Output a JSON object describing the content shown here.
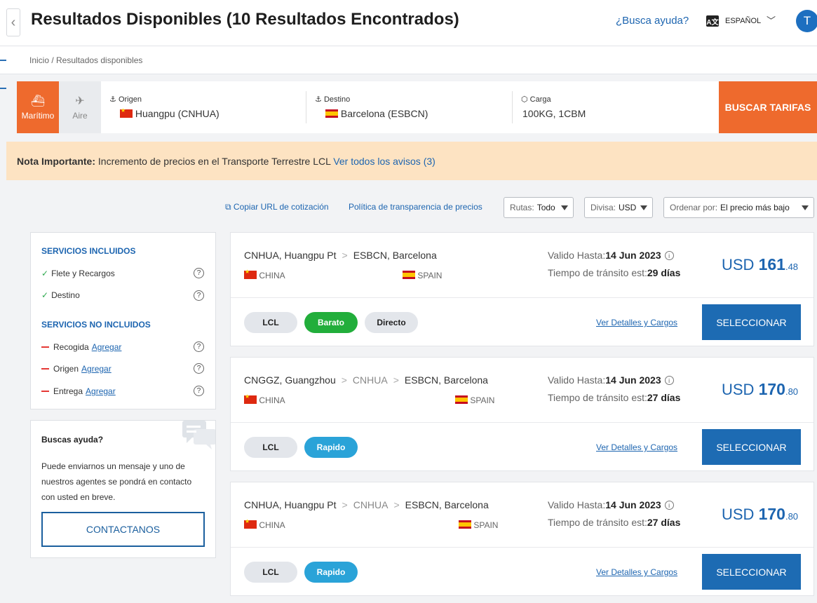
{
  "header": {
    "title": "Resultados Disponibles (10 Resultados Encontrados)",
    "help_link": "¿Busca ayuda?",
    "language": "ESPAÑOL",
    "avatar_initial": "T"
  },
  "breadcrumb": "Inicio / Resultados disponibles",
  "search": {
    "modes": [
      {
        "label": "Marítimo",
        "icon": "ship-icon",
        "active": true
      },
      {
        "label": "Aire",
        "icon": "plane-icon",
        "active": false
      }
    ],
    "origin_label": "Origen",
    "origin_value": "Huangpu (CNHUA)",
    "destination_label": "Destino",
    "destination_value": "Barcelona (ESBCN)",
    "cargo_label": "Carga",
    "cargo_value": "100KG, 1CBM",
    "button": "BUSCAR TARIFAS"
  },
  "notice": {
    "prefix": "Nota Importante:",
    "text": "Incremento de precios en el Transporte Terrestre LCL",
    "link": "Ver todos los avisos (3)"
  },
  "toolbar": {
    "copy_url": "Copiar URL de cotización",
    "policy": "Política de transparencia de precios",
    "routes_label": "Rutas:",
    "routes_value": "Todo",
    "currency_label": "Divisa:",
    "currency_value": "USD",
    "sort_label": "Ordenar por:",
    "sort_value": "El precio más bajo"
  },
  "services": {
    "included_title": "SERVICIOS INCLUIDOS",
    "included": [
      "Flete y Recargos",
      "Destino"
    ],
    "not_included_title": "SERVICIOS NO INCLUIDOS",
    "not_included": [
      "Recogida",
      "Origen",
      "Entrega"
    ],
    "add_label": "Agregar"
  },
  "help_box": {
    "title": "Buscas ayuda?",
    "text": "Puede enviarnos un mensaje y uno de nuestros agentes se pondrá en contacto con usted en breve.",
    "button": "CONTACTANOS"
  },
  "results": [
    {
      "route": [
        "CNHUA, Huangpu Pt",
        "ESBCN, Barcelona"
      ],
      "origin_country": "CHINA",
      "dest_country": "SPAIN",
      "valid_label": "Valido Hasta:",
      "valid": "14 Jun 2023",
      "transit_label": "Tiempo de tránsito est:",
      "transit": "29 días",
      "currency": "USD",
      "price_int": "161",
      "price_dec": ".48",
      "tags": [
        "LCL",
        "Barato",
        "Directo"
      ],
      "details": "Ver Detalles y Cargos",
      "select": "SELECCIONAR"
    },
    {
      "route": [
        "CNGGZ, Guangzhou",
        "CNHUA",
        "ESBCN, Barcelona"
      ],
      "origin_country": "CHINA",
      "dest_country": "SPAIN",
      "valid_label": "Valido Hasta:",
      "valid": "14 Jun 2023",
      "transit_label": "Tiempo de tránsito est:",
      "transit": "27 días",
      "currency": "USD",
      "price_int": "170",
      "price_dec": ".80",
      "tags": [
        "LCL",
        "Rapido"
      ],
      "details": "Ver Detalles y Cargos",
      "select": "SELECCIONAR"
    },
    {
      "route": [
        "CNHUA, Huangpu Pt",
        "CNHUA",
        "ESBCN, Barcelona"
      ],
      "origin_country": "CHINA",
      "dest_country": "SPAIN",
      "valid_label": "Valido Hasta:",
      "valid": "14 Jun 2023",
      "transit_label": "Tiempo de tránsito est:",
      "transit": "27 días",
      "currency": "USD",
      "price_int": "170",
      "price_dec": ".80",
      "tags": [
        "LCL",
        "Rapido"
      ],
      "details": "Ver Detalles y Cargos",
      "select": "SELECCIONAR"
    }
  ],
  "colors": {
    "accent": "#ee6a2d",
    "brand_blue": "#1d6bb3",
    "tag_green": "#22ae3b",
    "tag_blue": "#2aa3d8",
    "notice_bg": "#fde3c2"
  }
}
